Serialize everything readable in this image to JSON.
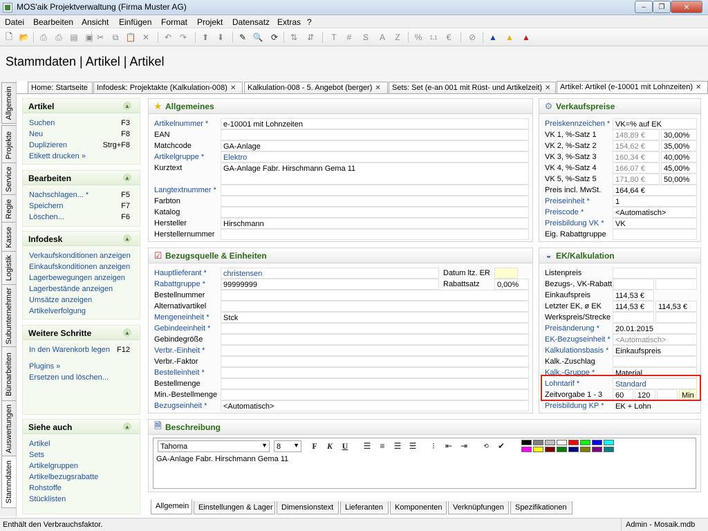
{
  "window": {
    "title": "MOS'aik Projektverwaltung (Firma Muster AG)",
    "minimize": "–",
    "maximize": "❐",
    "close": "✕"
  },
  "menu": [
    "Datei",
    "Bearbeiten",
    "Ansicht",
    "Einfügen",
    "Format",
    "Projekt",
    "Datensatz",
    "Extras",
    "?"
  ],
  "toolbar": {
    "icons": [
      "new-document",
      "open-folder",
      "save",
      "print",
      "print-preview",
      "cut",
      "copy",
      "paste",
      "delete",
      "undo",
      "redo",
      "move-up",
      "move-down",
      "edit-pencil",
      "find",
      "refresh",
      "sort",
      "bold-t",
      "hash",
      "s-letter",
      "a-letter",
      "z-letter",
      "percent",
      "number-format",
      "currency-format",
      "remove-user",
      "user-blue",
      "user-yellow",
      "user-red"
    ]
  },
  "heading": "Stammdaten | Artikel | Artikel",
  "doc_tabs": [
    {
      "label": "Home: Startseite",
      "closable": false
    },
    {
      "label": "Infodesk: Projektakte (Kalkulation-008)",
      "closable": true
    },
    {
      "label": "Kalkulation-008 - 5. Angebot (berger)",
      "closable": true
    },
    {
      "label": "Sets: Set (e-an 001 mit Rüst- und Artikelzeit)",
      "closable": true
    },
    {
      "label": "Artikel: Artikel (e-10001 mit Lohnzeiten)",
      "closable": true,
      "active": true
    }
  ],
  "vertical_tabs": [
    "Allgemein",
    "Projekte",
    "Service",
    "Regie",
    "Kasse",
    "Logistik",
    "Subunternehmer",
    "Büroarbeiten",
    "Auswertungen",
    "Stammdaten"
  ],
  "sidebar": {
    "artikel": {
      "title": "Artikel",
      "items": [
        {
          "label": "Suchen",
          "key": "F3"
        },
        {
          "label": "Neu",
          "key": "F8"
        },
        {
          "label": "Duplizieren",
          "key": "Strg+F8"
        },
        {
          "label": "Etikett drucken »",
          "key": ""
        }
      ]
    },
    "bearbeiten": {
      "title": "Bearbeiten",
      "items": [
        {
          "label": "Nachschlagen... *",
          "key": "F5"
        },
        {
          "label": "Speichern",
          "key": "F7"
        },
        {
          "label": "Löschen...",
          "key": "F6"
        }
      ]
    },
    "infodesk": {
      "title": "Infodesk",
      "items": [
        {
          "label": "Verkaufskonditionen anzeigen"
        },
        {
          "label": "Einkaufskonditionen anzeigen"
        },
        {
          "label": "Lagerbewegungen anzeigen"
        },
        {
          "label": "Lagerbestände anzeigen"
        },
        {
          "label": "Umsätze anzeigen"
        },
        {
          "label": "Artikelverfolgung"
        }
      ]
    },
    "weitere": {
      "title": "Weitere Schritte",
      "items": [
        {
          "label": "In den Warenkorb legen",
          "key": "F12"
        },
        {
          "label": "Plugins »",
          "key": ""
        },
        {
          "label": "Ersetzen und löschen...",
          "key": ""
        }
      ]
    },
    "siehe": {
      "title": "Siehe auch",
      "items": [
        {
          "label": "Artikel"
        },
        {
          "label": "Sets"
        },
        {
          "label": "Artikelgruppen"
        },
        {
          "label": "Artikelbezugsrabatte"
        },
        {
          "label": "Rohstoffe"
        },
        {
          "label": "Stücklisten"
        }
      ]
    }
  },
  "allgemeines": {
    "title": "Allgemeines",
    "rows": [
      {
        "label": "Artikelnummer *",
        "value": "e-10001 mit Lohnzeiten",
        "link": true
      },
      {
        "label": "EAN",
        "value": ""
      },
      {
        "label": "Matchcode",
        "value": "GA-Anlage"
      },
      {
        "label": "Artikelgruppe *",
        "value": "Elektro",
        "link": true
      },
      {
        "label": "Kurztext",
        "value": "GA-Anlage Fabr. Hirschmann Gema 11"
      },
      {
        "label": "Langtextnummer *",
        "value": "",
        "link": true
      },
      {
        "label": "Farbton",
        "value": ""
      },
      {
        "label": "Katalog",
        "value": ""
      },
      {
        "label": "Hersteller",
        "value": "Hirschmann"
      },
      {
        "label": "Herstellernummer",
        "value": ""
      }
    ]
  },
  "verkaufspreise": {
    "title": "Verkaufspreise",
    "rows": [
      {
        "label": "Preiskennzeichen *",
        "value": "VK=% auf EK",
        "link": true
      },
      {
        "label": "VK 1, %-Satz 1",
        "price": "148,89 €",
        "pct": "30,00%"
      },
      {
        "label": "VK 2, %-Satz 2",
        "price": "154,62 €",
        "pct": "35,00%"
      },
      {
        "label": "VK 3, %-Satz 3",
        "price": "160,34 €",
        "pct": "40,00%"
      },
      {
        "label": "VK 4, %-Satz 4",
        "price": "166,07 €",
        "pct": "45,00%"
      },
      {
        "label": "VK 5, %-Satz 5",
        "price": "171,80 €",
        "pct": "50,00%"
      },
      {
        "label": "Preis incl. MwSt.",
        "value": "164,64 €"
      },
      {
        "label": "Preiseinheit *",
        "value": "1",
        "link": true
      },
      {
        "label": "Preiscode *",
        "value": "<Automatisch>",
        "link": true
      },
      {
        "label": "Preisbildung VK *",
        "value": "VK",
        "link": true
      },
      {
        "label": "Eig. Rabattgruppe",
        "value": ""
      }
    ]
  },
  "bezugsquelle": {
    "title": "Bezugsquelle & Einheiten",
    "rows": [
      {
        "label": "Hauptlieferant *",
        "value": "christensen",
        "link": true,
        "blue": true,
        "extra_label": "Datum ltz. ER",
        "extra_value": ""
      },
      {
        "label": "Rabattgruppe *",
        "value": "99999999",
        "link": true,
        "extra_label": "Rabattsatz",
        "extra_value": "0,00%"
      },
      {
        "label": "Bestellnummer",
        "value": ""
      },
      {
        "label": "Alternativartikel",
        "value": ""
      },
      {
        "label": "Mengeneinheit *",
        "value": "Stck",
        "link": true
      },
      {
        "label": "Gebindeeinheit *",
        "value": "",
        "link": true
      },
      {
        "label": "Gebindegröße",
        "value": ""
      },
      {
        "label": "Verbr.-Einheit *",
        "value": "",
        "link": true
      },
      {
        "label": "Verbr.-Faktor",
        "value": ""
      },
      {
        "label": "Bestelleinheit *",
        "value": "",
        "link": true
      },
      {
        "label": "Bestellmenge",
        "value": ""
      },
      {
        "label": "Min.-Bestellmenge",
        "value": ""
      },
      {
        "label": "Bezugseinheit *",
        "value": "<Automatisch>",
        "link": true
      }
    ]
  },
  "ek": {
    "title": "EK/Kalkulation",
    "rows": [
      {
        "label": "Listenpreis",
        "value": "",
        "value2": ""
      },
      {
        "label": "Bezugs-, VK-Rabatt",
        "value": "",
        "value2": ""
      },
      {
        "label": "Einkaufspreis",
        "value": "114,53 €"
      },
      {
        "label": "Letzter EK, ø EK",
        "value": "114,53 €",
        "value2": "114,53 €"
      },
      {
        "label": "Werkspreis/Strecke",
        "value": "",
        "value2": ""
      },
      {
        "label": "Preisänderung *",
        "value": "20.01.2015",
        "link": true
      },
      {
        "label": "EK-Bezugseinheit *",
        "value": "<Automatisch>",
        "link": true,
        "gray": true
      },
      {
        "label": "Kalkulationsbasis *",
        "value": "Einkaufspreis",
        "link": true
      },
      {
        "label": "Kalk.-Zuschlag",
        "value": ""
      },
      {
        "label": "Kalk.-Gruppe *",
        "value": "Material",
        "link": true
      },
      {
        "label": "Lohntarif *",
        "value": "Standard",
        "link": true,
        "blue": true
      },
      {
        "label": "Zeitvorgabe 1 - 3",
        "z1": "60",
        "z2": "120",
        "z3": "",
        "unit": "Min"
      },
      {
        "label": "Preisbildung KP *",
        "value": "EK + Lohn",
        "link": true
      }
    ]
  },
  "beschreibung": {
    "title": "Beschreibung",
    "font": "Tahoma",
    "size": "8",
    "text": "GA-Anlage Fabr. Hirschmann Gema 11",
    "colors": [
      "#000000",
      "#808080",
      "#c0c0c0",
      "#ffffff",
      "#ff0000",
      "#00ff00",
      "#0000ff",
      "#00ffff",
      "#ff00ff",
      "#ffff00",
      "#800000",
      "#008000",
      "#000080",
      "#808000",
      "#800080",
      "#008080"
    ]
  },
  "bottom_tabs": [
    "Allgemein",
    "Einstellungen & Lager",
    "Dimensionstext",
    "Lieferanten",
    "Komponenten",
    "Verknüpfungen",
    "Spezifikationen"
  ],
  "status": {
    "text": "Enthält den Verbrauchsfaktor.",
    "right": "Admin - Mosaik.mdb"
  }
}
